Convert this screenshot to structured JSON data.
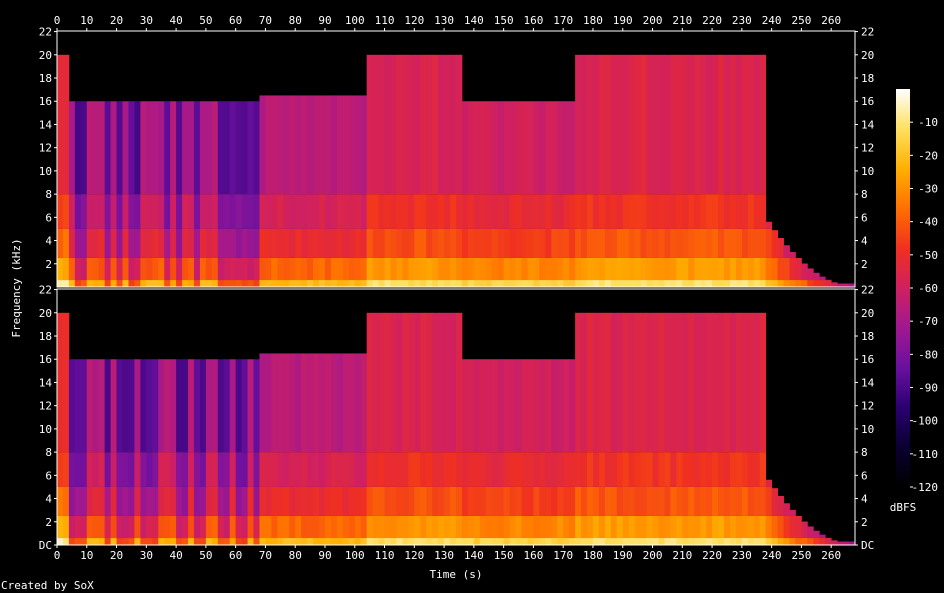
{
  "chart_data": {
    "type": "heatmap",
    "title": "",
    "xlabel": "Time (s)",
    "ylabel": "Frequency (kHz)",
    "colorbar_label": "dBFS",
    "xlim": [
      0,
      268
    ],
    "ylim_khz": [
      0,
      22.05
    ],
    "x_ticks": [
      0,
      10,
      20,
      30,
      40,
      50,
      60,
      70,
      80,
      90,
      100,
      110,
      120,
      130,
      140,
      150,
      160,
      170,
      180,
      190,
      200,
      210,
      220,
      230,
      240,
      250,
      260
    ],
    "y_ticks": [
      {
        "value": 0,
        "label": "DC"
      },
      {
        "value": 2,
        "label": "2"
      },
      {
        "value": 4,
        "label": "4"
      },
      {
        "value": 6,
        "label": "6"
      },
      {
        "value": 8,
        "label": "8"
      },
      {
        "value": 10,
        "label": "10"
      },
      {
        "value": 12,
        "label": "12"
      },
      {
        "value": 14,
        "label": "14"
      },
      {
        "value": 16,
        "label": "16"
      },
      {
        "value": 18,
        "label": "18"
      },
      {
        "value": 20,
        "label": "20"
      },
      {
        "value": 22,
        "label": "22"
      }
    ],
    "colorbar_ticks": [
      {
        "value": -10,
        "label": "-10"
      },
      {
        "value": -20,
        "label": "-20"
      },
      {
        "value": -30,
        "label": "-30"
      },
      {
        "value": -40,
        "label": "-40"
      },
      {
        "value": -50,
        "label": "-50"
      },
      {
        "value": -60,
        "label": "-60"
      },
      {
        "value": -70,
        "label": "-70"
      },
      {
        "value": -80,
        "label": "-80"
      },
      {
        "value": -90,
        "label": "-90"
      },
      {
        "value": -100,
        "label": "-100"
      },
      {
        "value": -110,
        "label": "-110"
      },
      {
        "value": -120,
        "label": "-120"
      }
    ],
    "colorbar_range_dbfs": [
      -120,
      0
    ],
    "channels": 2,
    "segments": [
      {
        "t_start": 0,
        "t_end": 4,
        "cutoff_khz": 20,
        "level_dbfs": -52
      },
      {
        "t_start": 4,
        "t_end": 68,
        "cutoff_khz": 16,
        "level_dbfs": -80,
        "sparse": true
      },
      {
        "t_start": 68,
        "t_end": 104,
        "cutoff_khz": 16.5,
        "level_dbfs": -66
      },
      {
        "t_start": 104,
        "t_end": 136,
        "cutoff_khz": 20,
        "level_dbfs": -57
      },
      {
        "t_start": 136,
        "t_end": 173,
        "cutoff_khz": 16,
        "level_dbfs": -60
      },
      {
        "t_start": 173,
        "t_end": 237,
        "cutoff_khz": 20,
        "level_dbfs": -56
      },
      {
        "t_start": 237,
        "t_end": 268,
        "cutoff_khz": 16,
        "level_dbfs": -105,
        "fade_out": true
      }
    ],
    "colormap": [
      "#000000",
      "#0a0030",
      "#2a0070",
      "#6a10a0",
      "#a01890",
      "#d02060",
      "#f03020",
      "#ff7000",
      "#ffb000",
      "#ffe060",
      "#ffffff"
    ],
    "grid": false,
    "legend": "colorbar-right"
  },
  "footer": {
    "credit": "Created by SoX"
  }
}
